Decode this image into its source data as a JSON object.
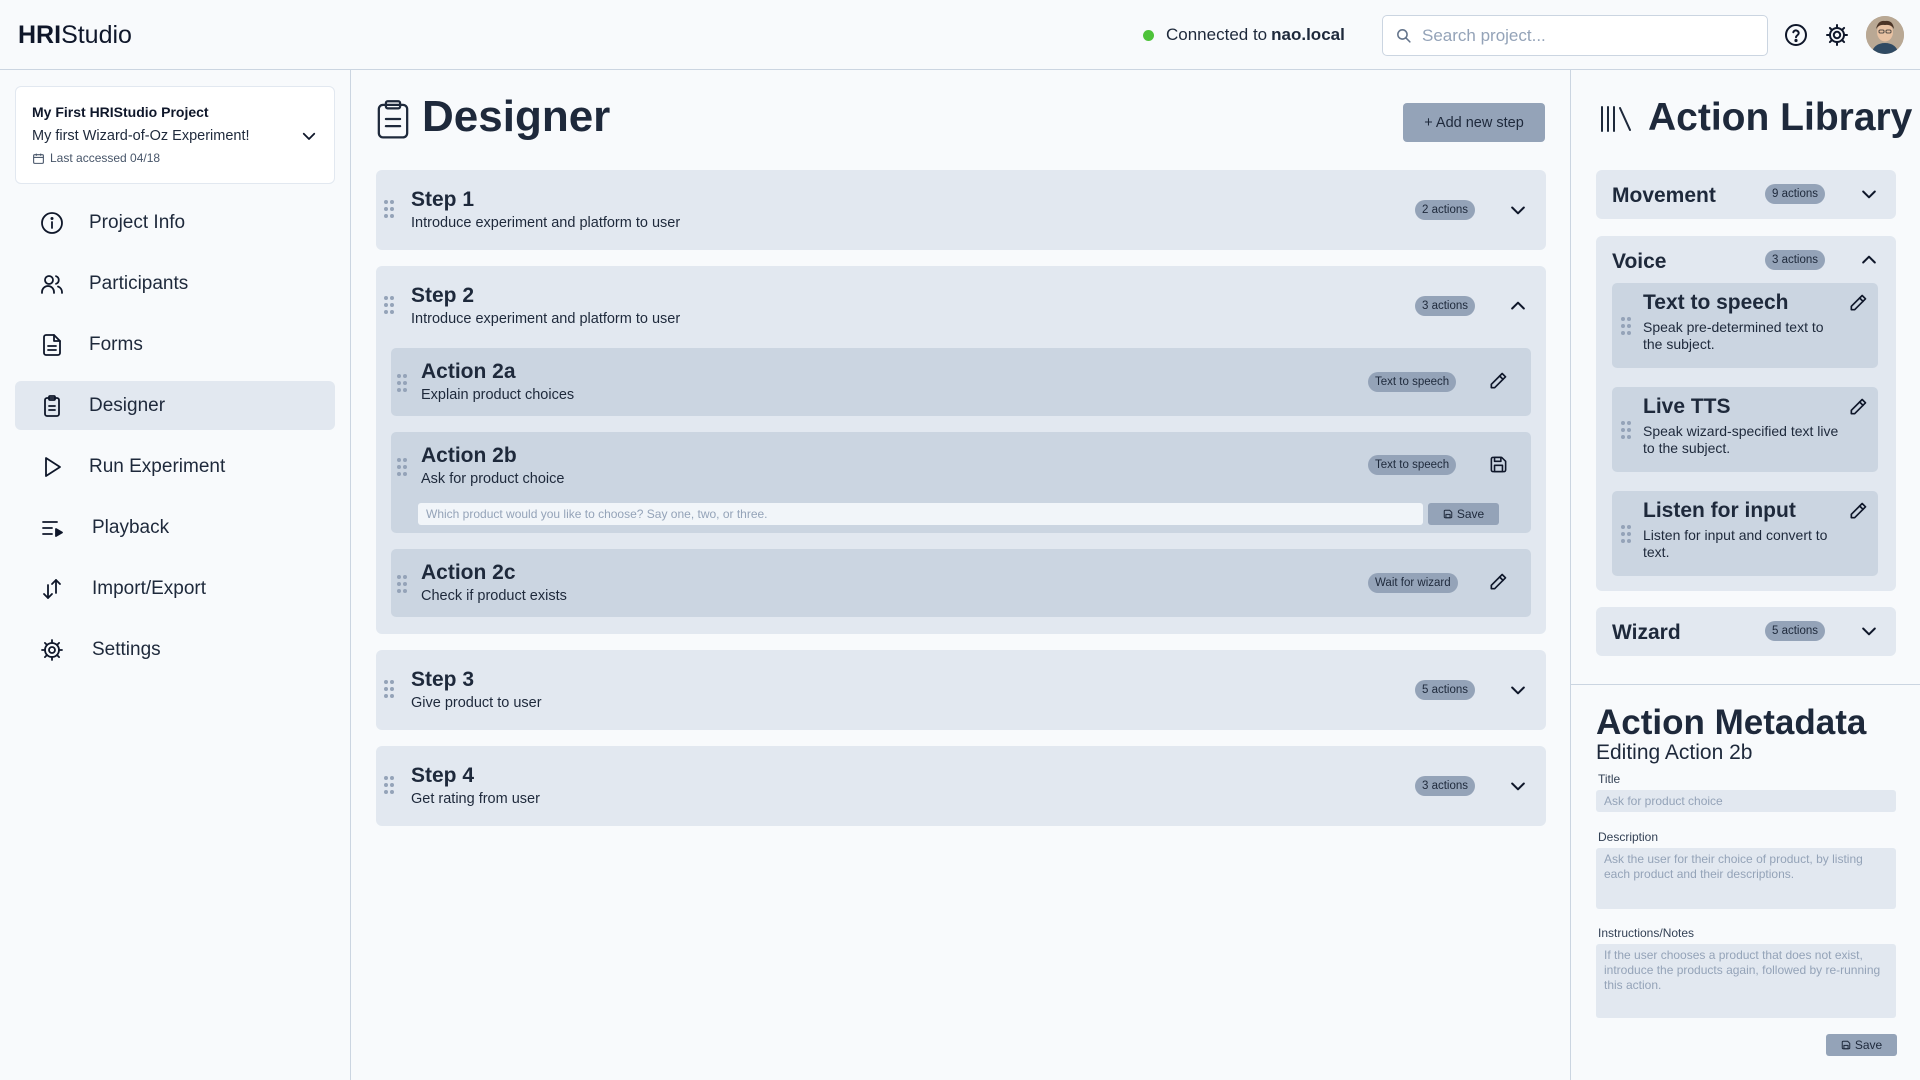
{
  "app": {
    "logo_bold": "HRI",
    "logo_rest": "Studio"
  },
  "topbar": {
    "connection_prefix": "Connected to",
    "connection_host": "nao.local",
    "status_color": "#4ec33a",
    "search_placeholder": "Search project...",
    "icons": [
      "help-icon",
      "gear-icon",
      "avatar"
    ]
  },
  "project": {
    "title": "My First HRIStudio Project",
    "experiment": "My first Wizard-of-Oz Experiment!",
    "last_accessed": "Last accessed 04/18"
  },
  "nav": [
    {
      "label": "Project Info",
      "icon": "info-icon"
    },
    {
      "label": "Participants",
      "icon": "users-icon"
    },
    {
      "label": "Forms",
      "icon": "document-icon"
    },
    {
      "label": "Designer",
      "icon": "clipboard-icon",
      "active": true
    },
    {
      "label": "Run Experiment",
      "icon": "play-icon"
    },
    {
      "label": "Playback",
      "icon": "playlist-icon"
    },
    {
      "label": "Import/Export",
      "icon": "transfer-icon"
    },
    {
      "label": "Settings",
      "icon": "gear-icon"
    }
  ],
  "designer": {
    "title": "Designer",
    "add_step_label": "+ Add new step",
    "steps": [
      {
        "title": "Step 1",
        "description": "Introduce experiment and platform to user",
        "badge": "2 actions",
        "expanded": false
      },
      {
        "title": "Step 2",
        "description": "Introduce experiment and platform to user",
        "badge": "3 actions",
        "expanded": true,
        "actions": [
          {
            "title": "Action 2a",
            "description": "Explain product choices",
            "tag": "Text to speech",
            "icon": "pencil-icon"
          },
          {
            "title": "Action 2b",
            "description": "Ask for product choice",
            "tag": "Text to speech",
            "icon": "save-icon",
            "input_placeholder": "Which product would you like to choose? Say one, two, or three.",
            "save_label": "Save"
          },
          {
            "title": "Action 2c",
            "description": "Check if product exists",
            "tag": "Wait for wizard",
            "icon": "pencil-icon"
          }
        ]
      },
      {
        "title": "Step 3",
        "description": "Give product to user",
        "badge": "5 actions",
        "expanded": false
      },
      {
        "title": "Step 4",
        "description": "Get rating from user",
        "badge": "3 actions",
        "expanded": false
      }
    ]
  },
  "library": {
    "title": "Action Library",
    "categories": [
      {
        "name": "Movement",
        "badge": "9 actions",
        "expanded": false
      },
      {
        "name": "Voice",
        "badge": "3 actions",
        "expanded": true,
        "items": [
          {
            "title": "Text to speech",
            "description": "Speak pre-determined text to the subject."
          },
          {
            "title": "Live TTS",
            "description": "Speak wizard-specified text live to the subject."
          },
          {
            "title": "Listen for input",
            "description": "Listen for input and convert to text."
          }
        ]
      },
      {
        "name": "Wizard",
        "badge": "5 actions",
        "expanded": false
      }
    ]
  },
  "metadata": {
    "title": "Action Metadata",
    "subtitle": "Editing Action 2b",
    "title_label": "Title",
    "title_placeholder": "Ask for product choice",
    "description_label": "Description",
    "description_placeholder": "Ask the user for their choice of product, by listing each product and their descriptions.",
    "notes_label": "Instructions/Notes",
    "notes_placeholder": "If the user chooses a product that does not exist, introduce the products again, followed by re-running this action.",
    "save_label": "Save"
  },
  "colors": {
    "background": "#f8fafc",
    "panel": "#e2e8f0",
    "card": "#cbd5e1",
    "badge": "#94a3b8",
    "text": "#1e293b"
  }
}
